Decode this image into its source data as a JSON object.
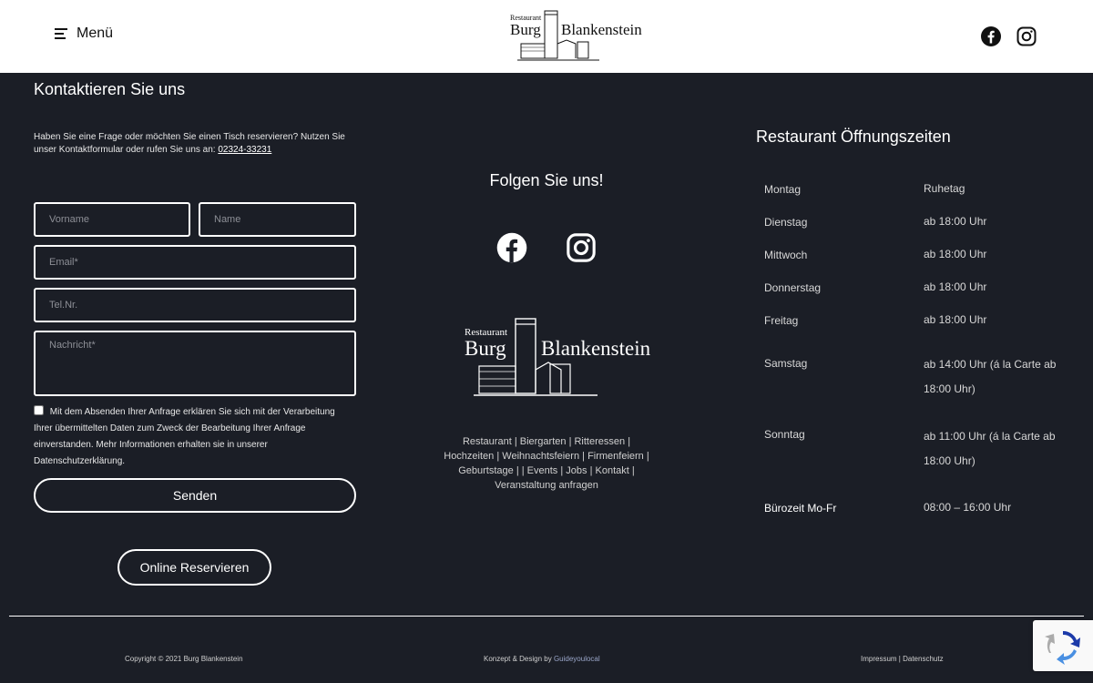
{
  "header": {
    "menu_label": "Menü",
    "logo_small": "Restaurant",
    "logo_left": "Burg",
    "logo_right": "Blankenstein"
  },
  "contact": {
    "title": "Kontaktieren Sie uns",
    "description": "Haben Sie eine Frage oder möchten Sie einen Tisch reservieren? Nutzen Sie unser Kontaktformular oder rufen Sie uns an:",
    "phone": "02324-33231",
    "placeholders": {
      "first_name": "Vorname",
      "last_name": "Name",
      "email": "Email*",
      "phone": "Tel.Nr.",
      "message": "Nachricht*"
    },
    "consent": "Mit dem Absenden Ihrer Anfrage erklären Sie sich mit der Verarbeitung Ihrer übermittelten Daten zum Zweck der Bearbeitung Ihrer Anfrage einverstanden. Mehr Informationen erhalten sie in unserer Datenschutzerklärung.",
    "send_label": "Senden",
    "reserve_label": "Online Reservieren"
  },
  "follow": {
    "title": "Folgen Sie uns!",
    "logo_small": "Restaurant",
    "logo_left": "Burg",
    "logo_right": "Blankenstein",
    "links": [
      "Restaurant",
      "Biergarten",
      "Ritteressen",
      "Hochzeiten",
      "Weihnachtsfeiern",
      "Firmenfeiern",
      "Geburtstage",
      "Events",
      "Jobs",
      "Kontakt",
      "Veranstaltung anfragen"
    ]
  },
  "hours": {
    "title": "Restaurant Öffnungszeiten",
    "rows": [
      {
        "day": "Montag",
        "time": "Ruhetag"
      },
      {
        "day": "Dienstag",
        "time": "ab 18:00 Uhr"
      },
      {
        "day": "Mittwoch",
        "time": "ab 18:00 Uhr"
      },
      {
        "day": "Donnerstag",
        "time": "ab 18:00 Uhr"
      },
      {
        "day": "Freitag",
        "time": "ab 18:00 Uhr"
      },
      {
        "day": "Samstag",
        "time": "ab 14:00 Uhr (á la Carte ab 18:00 Uhr)"
      },
      {
        "day": "Sonntag",
        "time": "ab 11:00 Uhr (á la Carte ab 18:00 Uhr)"
      },
      {
        "day": "Bürozeit Mo-Fr",
        "time": "08:00 – 16:00 Uhr"
      }
    ]
  },
  "footer": {
    "copyright": "Copyright © 2021 Burg Blankenstein",
    "design_prefix": "Konzept & Design by",
    "design_link": "Guideyoulocal",
    "impressum": "Impressum",
    "separator": "|",
    "datenschutz": "Datenschutz"
  },
  "colors": {
    "background": "#1b1e26",
    "header_bg": "#ffffff",
    "link_accent": "#9aa6c9"
  }
}
